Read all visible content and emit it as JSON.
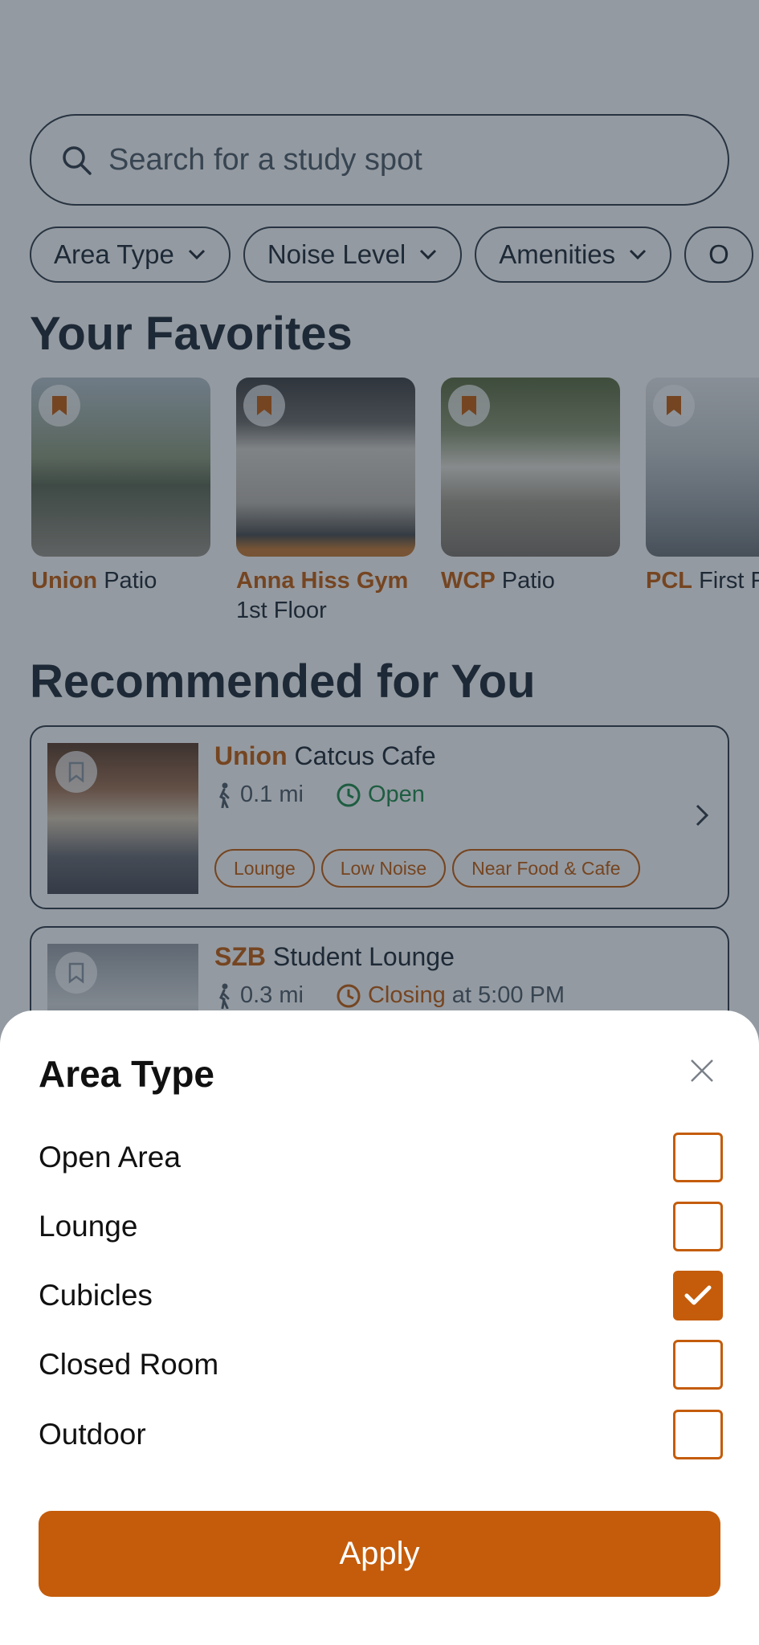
{
  "search": {
    "placeholder": "Search for a study spot"
  },
  "filters": [
    {
      "label": "Area Type"
    },
    {
      "label": "Noise Level"
    },
    {
      "label": "Amenities"
    },
    {
      "label": "O"
    }
  ],
  "favorites": {
    "heading": "Your Favorites",
    "items": [
      {
        "building": "Union",
        "place": "Patio"
      },
      {
        "building": "Anna Hiss Gym",
        "place": "1st Floor"
      },
      {
        "building": "WCP",
        "place": "Patio"
      },
      {
        "building": "PCL",
        "place": "First F"
      }
    ]
  },
  "recommended": {
    "heading": "Recommended for You",
    "items": [
      {
        "building": "Union",
        "place": "Catcus Cafe",
        "distance": "0.1 mi",
        "status": "Open",
        "status_suffix": "",
        "tags": [
          "Lounge",
          "Low Noise",
          "Near Food & Cafe"
        ]
      },
      {
        "building": "SZB",
        "place": "Student Lounge",
        "distance": "0.3 mi",
        "status": "Closing",
        "status_suffix": "at 5:00 PM",
        "tags": []
      }
    ]
  },
  "sheet": {
    "title": "Area Type",
    "options": [
      {
        "label": "Open Area",
        "checked": false
      },
      {
        "label": "Lounge",
        "checked": false
      },
      {
        "label": "Cubicles",
        "checked": true
      },
      {
        "label": "Closed Room",
        "checked": false
      },
      {
        "label": "Outdoor",
        "checked": false
      }
    ],
    "apply_label": "Apply"
  },
  "colors": {
    "accent": "#c45c0b",
    "open": "#1e8a49",
    "scrim": "#202c3a"
  }
}
